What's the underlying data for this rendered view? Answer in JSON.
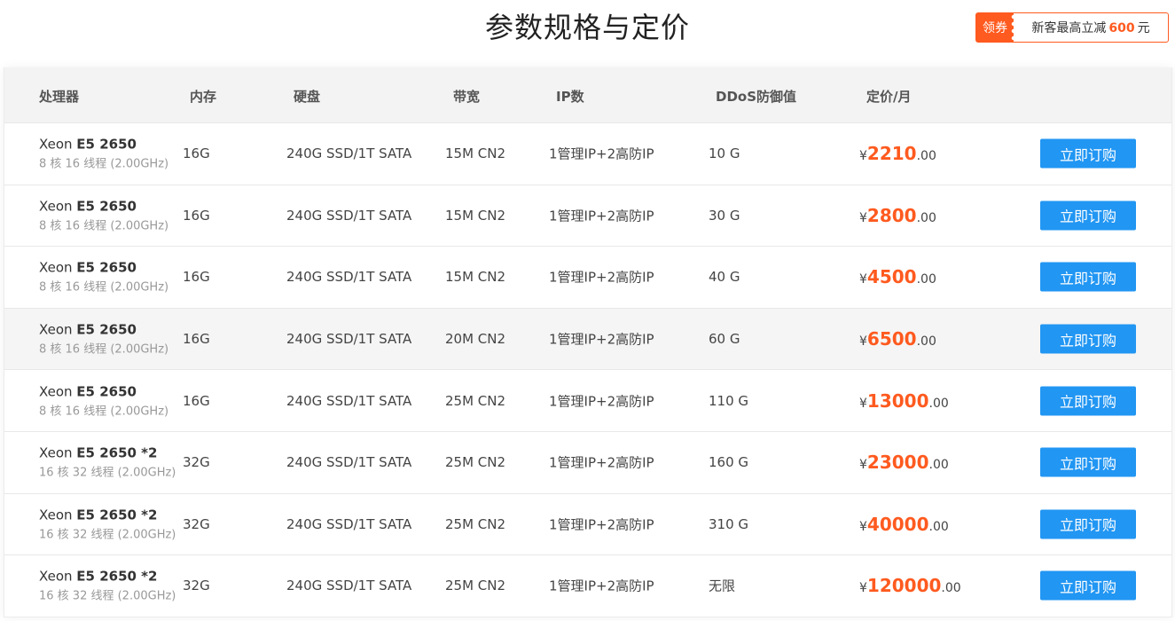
{
  "page": {
    "title": "参数规格与定价"
  },
  "coupon": {
    "tag": "领券",
    "text_prefix": "新客最高立减",
    "amount": "600",
    "unit": "元"
  },
  "table": {
    "headers": [
      "处理器",
      "内存",
      "硬盘",
      "带宽",
      "IP数",
      "DDoS防御值",
      "定价/月"
    ],
    "rows": [
      {
        "cpu_brand": "Xeon",
        "cpu_model": "E5 2650",
        "cpu_detail": "8 核 16 线程 (2.00GHz)",
        "memory": "16G",
        "disk": "240G SSD/1T SATA",
        "bandwidth": "15M CN2",
        "ip": "1管理IP+2高防IP",
        "ddos": "10 G",
        "price_symbol": "¥",
        "price_int": "2210",
        "price_dec": ".00",
        "buy_label": "立即订购"
      },
      {
        "cpu_brand": "Xeon",
        "cpu_model": "E5 2650",
        "cpu_detail": "8 核 16 线程 (2.00GHz)",
        "memory": "16G",
        "disk": "240G SSD/1T SATA",
        "bandwidth": "15M CN2",
        "ip": "1管理IP+2高防IP",
        "ddos": "30 G",
        "price_symbol": "¥",
        "price_int": "2800",
        "price_dec": ".00",
        "buy_label": "立即订购"
      },
      {
        "cpu_brand": "Xeon",
        "cpu_model": "E5 2650",
        "cpu_detail": "8 核 16 线程 (2.00GHz)",
        "memory": "16G",
        "disk": "240G SSD/1T SATA",
        "bandwidth": "15M CN2",
        "ip": "1管理IP+2高防IP",
        "ddos": "40 G",
        "price_symbol": "¥",
        "price_int": "4500",
        "price_dec": ".00",
        "buy_label": "立即订购"
      },
      {
        "cpu_brand": "Xeon",
        "cpu_model": "E5 2650",
        "cpu_detail": "8 核 16 线程 (2.00GHz)",
        "memory": "16G",
        "disk": "240G SSD/1T SATA",
        "bandwidth": "20M CN2",
        "ip": "1管理IP+2高防IP",
        "ddos": "60 G",
        "price_symbol": "¥",
        "price_int": "6500",
        "price_dec": ".00",
        "buy_label": "立即订购"
      },
      {
        "cpu_brand": "Xeon",
        "cpu_model": "E5 2650",
        "cpu_detail": "8 核 16 线程 (2.00GHz)",
        "memory": "16G",
        "disk": "240G SSD/1T SATA",
        "bandwidth": "25M CN2",
        "ip": "1管理IP+2高防IP",
        "ddos": "110 G",
        "price_symbol": "¥",
        "price_int": "13000",
        "price_dec": ".00",
        "buy_label": "立即订购"
      },
      {
        "cpu_brand": "Xeon",
        "cpu_model": "E5 2650 *2",
        "cpu_detail": "16 核 32 线程 (2.00GHz)",
        "memory": "32G",
        "disk": "240G SSD/1T SATA",
        "bandwidth": "25M CN2",
        "ip": "1管理IP+2高防IP",
        "ddos": "160 G",
        "price_symbol": "¥",
        "price_int": "23000",
        "price_dec": ".00",
        "buy_label": "立即订购"
      },
      {
        "cpu_brand": "Xeon",
        "cpu_model": "E5 2650 *2",
        "cpu_detail": "16 核 32 线程 (2.00GHz)",
        "memory": "32G",
        "disk": "240G SSD/1T SATA",
        "bandwidth": "25M CN2",
        "ip": "1管理IP+2高防IP",
        "ddos": "310 G",
        "price_symbol": "¥",
        "price_int": "40000",
        "price_dec": ".00",
        "buy_label": "立即订购"
      },
      {
        "cpu_brand": "Xeon",
        "cpu_model": "E5 2650 *2",
        "cpu_detail": "16 核 32 线程 (2.00GHz)",
        "memory": "32G",
        "disk": "240G SSD/1T SATA",
        "bandwidth": "25M CN2",
        "ip": "1管理IP+2高防IP",
        "ddos": "无限",
        "price_symbol": "¥",
        "price_int": "120000",
        "price_dec": ".00",
        "buy_label": "立即订购"
      }
    ]
  },
  "colors": {
    "accent": "#ff5a1f",
    "button": "#2196f3",
    "header_bg": "#f3f3f3"
  }
}
